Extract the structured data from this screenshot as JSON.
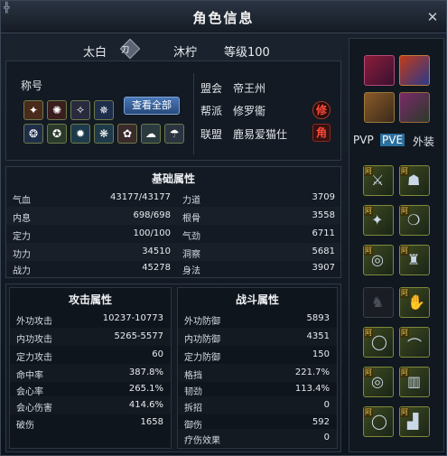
{
  "window": {
    "title": "角色信息",
    "corner_glyph": "╬"
  },
  "identity": {
    "name": "太白",
    "sect_badge": "刀",
    "server": "沐柠",
    "level": "等级100"
  },
  "titles": {
    "label": "称号",
    "view_all": "查看全部"
  },
  "guild": {
    "alliance_label": "盟会",
    "alliance_value": "帝王州",
    "faction_label": "帮派",
    "faction_value": "修罗衞",
    "league_label": "联盟",
    "league_value": "鹿易爱猫仕",
    "faction_badge": "修",
    "league_badge": "角"
  },
  "base": {
    "title": "基础属性",
    "left": [
      {
        "k": "气血",
        "v": "43177/43177"
      },
      {
        "k": "内息",
        "v": "698/698"
      },
      {
        "k": "定力",
        "v": "100/100"
      },
      {
        "k": "功力",
        "v": "34510"
      },
      {
        "k": "战力",
        "v": "45278"
      }
    ],
    "right": [
      {
        "k": "力道",
        "v": "3709"
      },
      {
        "k": "根骨",
        "v": "3558"
      },
      {
        "k": "气劲",
        "v": "6711"
      },
      {
        "k": "洞察",
        "v": "5681"
      },
      {
        "k": "身法",
        "v": "3907"
      }
    ]
  },
  "attack": {
    "title": "攻击属性",
    "rows": [
      {
        "k": "外功攻击",
        "v": "10237-10773"
      },
      {
        "k": "内功攻击",
        "v": "5265-5577"
      },
      {
        "k": "定力攻击",
        "v": "60"
      },
      {
        "k": "命中率",
        "v": "387.8%"
      },
      {
        "k": "会心率",
        "v": "265.1%"
      },
      {
        "k": "会心伤害",
        "v": "414.6%"
      },
      {
        "k": "破伤",
        "v": "1658"
      }
    ]
  },
  "battle": {
    "title": "战斗属性",
    "rows": [
      {
        "k": "外功防御",
        "v": "5893"
      },
      {
        "k": "内功防御",
        "v": "4351"
      },
      {
        "k": "定力防御",
        "v": "150"
      },
      {
        "k": "格挡",
        "v": "221.7%"
      },
      {
        "k": "韧劲",
        "v": "113.4%"
      },
      {
        "k": "拆招",
        "v": "0"
      },
      {
        "k": "御伤",
        "v": "592"
      },
      {
        "k": "疗伤效果",
        "v": "0"
      }
    ]
  },
  "right_panel": {
    "tabs": [
      "PVP",
      "PVE",
      "外装"
    ],
    "active_tab": "PVE",
    "equip_mark": "阿"
  },
  "colors": {
    "accent": "#2b6f9e",
    "gold": "#e8c25a",
    "faction_red": "#ff4a3a"
  }
}
